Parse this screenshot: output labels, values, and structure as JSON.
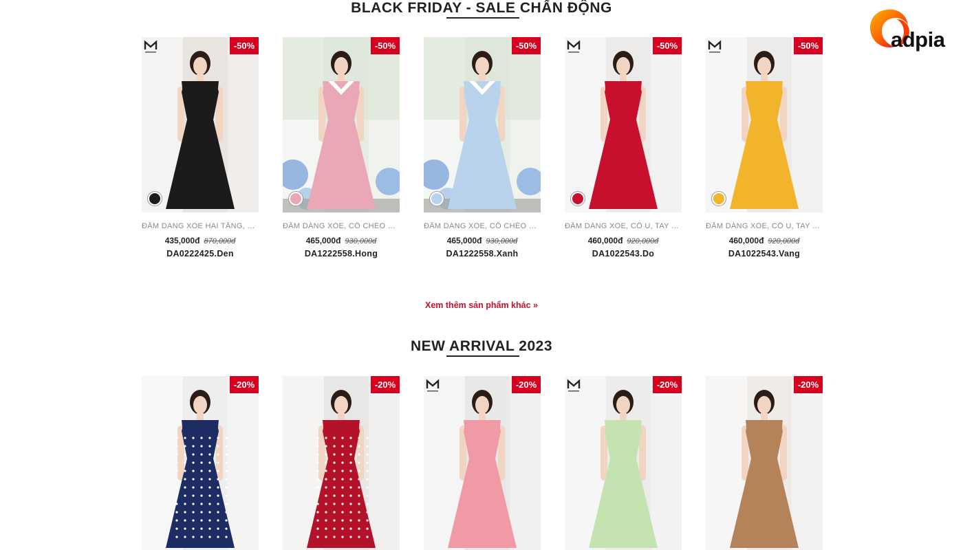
{
  "sections": {
    "sale_title": "BLACK FRIDAY - SALE CHẤN ĐỘNG",
    "new_title": "NEW ARRIVAL 2023"
  },
  "more_link": "Xem thêm sản phẩm khác »",
  "brand": {
    "watermark": "adpia",
    "mini_logo": "M",
    "mini_sub": "OUTFIT"
  },
  "sale_products": [
    {
      "badge": "-50%",
      "name": "ĐẦM DÁNG XÒE HAI TẦNG, CỔ VUÔNG",
      "price": "435,000đ",
      "old_price": "870,000đ",
      "code": "DA0222425.Den",
      "color": "#1b1b1b",
      "bg": "#e8e4e0"
    },
    {
      "badge": "-50%",
      "name": "ĐẦM DÁNG XÒE, CỔ CHÉO PHỐI TRẮNG",
      "price": "465,000đ",
      "old_price": "930,000đ",
      "code": "DA1222558.Hong",
      "color": "#eaa7b6",
      "bg": "#e6ece4"
    },
    {
      "badge": "-50%",
      "name": "ĐẦM DÁNG XÒE, CỔ CHÉO PHỐI TRẮNG",
      "price": "465,000đ",
      "old_price": "930,000đ",
      "code": "DA1222558.Xanh",
      "color": "#b9d3ec",
      "bg": "#e6ece4"
    },
    {
      "badge": "-50%",
      "name": "ĐẦM DÁNG XÒE, CỔ U, TAY BỒNG",
      "price": "460,000đ",
      "old_price": "920,000đ",
      "code": "DA1022543.Do",
      "color": "#c8102e",
      "bg": "#ecebea"
    },
    {
      "badge": "-50%",
      "name": "ĐẦM DÁNG XÒE, CỔ U, TAY BỒNG",
      "price": "460,000đ",
      "old_price": "920,000đ",
      "code": "DA1022543.Vang",
      "color": "#f2b42a",
      "bg": "#ecebea"
    }
  ],
  "new_products": [
    {
      "badge": "-20%",
      "color": "#1d2c63",
      "bg": "#eeeeee",
      "dots": "#ffffff"
    },
    {
      "badge": "-20%",
      "color": "#b3122a",
      "bg": "#e9e7e5",
      "dots": "#ffffff"
    },
    {
      "badge": "-20%",
      "color": "#ef9aa5",
      "bg": "#e8e8e8",
      "dots": ""
    },
    {
      "badge": "-20%",
      "color": "#c5e3b0",
      "bg": "#ececec",
      "dots": ""
    },
    {
      "badge": "-20%",
      "color": "#b5835a",
      "bg": "#efece8",
      "dots": ""
    }
  ]
}
